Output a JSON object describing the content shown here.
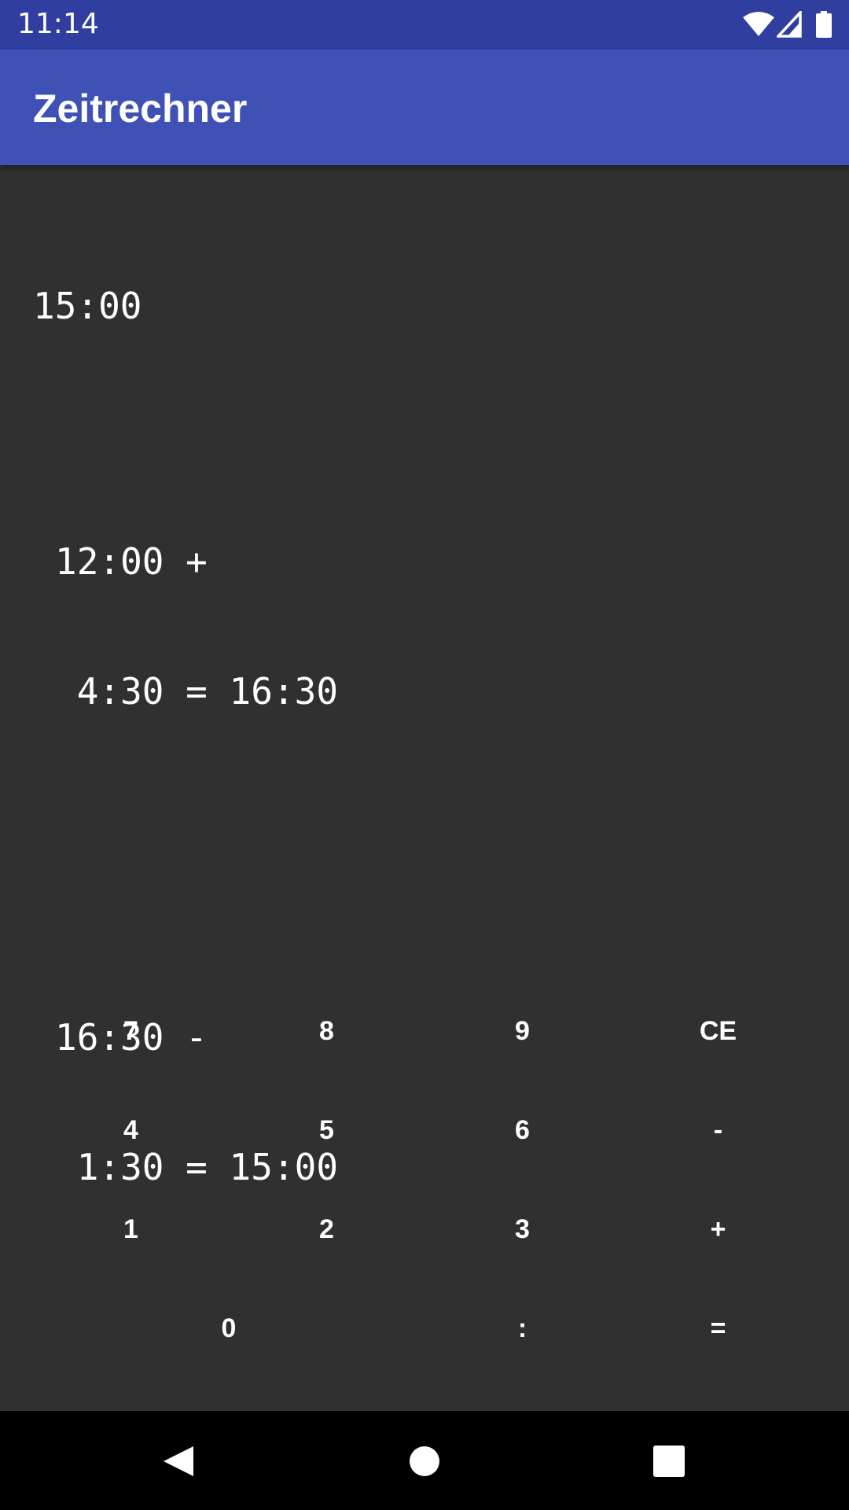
{
  "status_bar": {
    "time": "11:14",
    "icons": [
      "wifi-icon",
      "signal-icon",
      "battery-icon"
    ]
  },
  "app_bar": {
    "title": "Zeitrechner"
  },
  "display": {
    "current": "15:00",
    "history": [
      {
        "lines": [
          "12:00 +",
          " 4:30 = 16:30"
        ]
      },
      {
        "lines": [
          "16:30 -",
          " 1:30 = 15:00"
        ]
      }
    ]
  },
  "keypad": {
    "keys": [
      {
        "label": "7",
        "name": "key-7"
      },
      {
        "label": "8",
        "name": "key-8"
      },
      {
        "label": "9",
        "name": "key-9"
      },
      {
        "label": "CE",
        "name": "key-clear-entry"
      },
      {
        "label": "4",
        "name": "key-4"
      },
      {
        "label": "5",
        "name": "key-5"
      },
      {
        "label": "6",
        "name": "key-6"
      },
      {
        "label": "-",
        "name": "key-minus"
      },
      {
        "label": "1",
        "name": "key-1"
      },
      {
        "label": "2",
        "name": "key-2"
      },
      {
        "label": "3",
        "name": "key-3"
      },
      {
        "label": "+",
        "name": "key-plus"
      },
      {
        "label": "0",
        "name": "key-0"
      },
      {
        "label": ":",
        "name": "key-colon"
      },
      {
        "label": "=",
        "name": "key-equals"
      }
    ]
  },
  "nav_bar": {
    "buttons": [
      "back-icon",
      "home-icon",
      "recents-icon"
    ]
  },
  "colors": {
    "status_bar": "#303F9F",
    "app_bar": "#3F51B5",
    "background": "#303030",
    "nav_bar": "#000000",
    "text": "#FFFFFF"
  }
}
